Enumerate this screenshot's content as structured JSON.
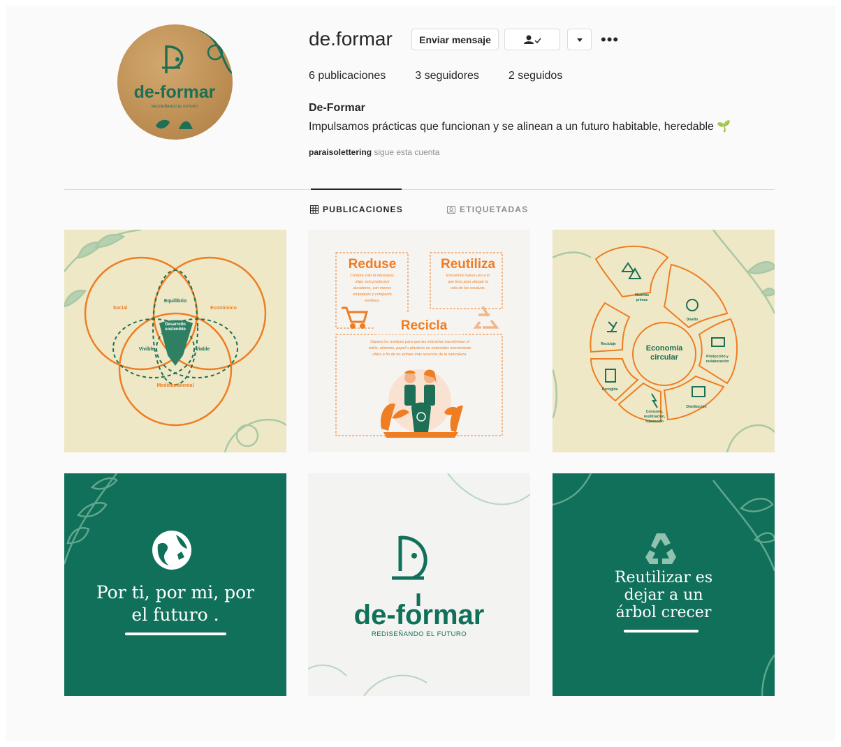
{
  "profile": {
    "username": "de.formar",
    "message_button": "Enviar mensaje",
    "more_dots": "•••",
    "stats": {
      "posts": "6 publicaciones",
      "followers": "3 seguidores",
      "following": "2 seguidos"
    },
    "full_name": "De-Formar",
    "bio": "Impulsamos prácticas que funcionan y se alinean a un futuro habitable, heredable 🌱",
    "followed_by_user": "paraisolettering",
    "followed_by_text": " sigue esta cuenta",
    "avatar": {
      "brand": "de-formar",
      "tagline": "REDISEÑANDO EL FUTURO"
    }
  },
  "tabs": {
    "posts": "PUBLICACIONES",
    "tagged": "ETIQUETADAS"
  },
  "posts": {
    "venn": {
      "social": "Social",
      "economico": "Económico",
      "medioambiental": "Medioambiental",
      "equilibrio": "Equilibrio",
      "desarrollo_1": "Desarrollo",
      "desarrollo_2": "sostenible",
      "vivible": "Vivible",
      "viable": "Viable"
    },
    "rrr": {
      "reduse": "Reduse",
      "reutiliza": "Reutiliza",
      "recicla": "Recicla",
      "reduse_1": "Compra solo lo necesario,",
      "reduse_2": "elige solo productos",
      "reduse_3": "duraderos, con menos",
      "reduse_4": "empaques y compacta",
      "reduse_5": "residuos.",
      "reutiliza_1": "Encuentra nuevo uso a lo",
      "reutiliza_2": "que tiras para alargar la",
      "reutiliza_3": "vida de los residuos.",
      "recicla_1": "Separa los residuos para que las industrias transformen el",
      "recicla_2": "vidrio, aluminio, papel o plásticos en materiales nuevamente",
      "recicla_3": "útiles a fin de no extraer más recursos de la naturaleza."
    },
    "circular": {
      "title_1": "Economía",
      "title_2": "circular",
      "materias": "Materias",
      "primas": "primas",
      "diseno": "Diseño",
      "produccion_1": "Producción y",
      "produccion_2": "reelaboración",
      "distribucion": "Distribución",
      "consumo_1": "Consumo,",
      "consumo_2": "reutilización,",
      "consumo_3": "reparación",
      "recogida": "Recogida",
      "reciclaje": "Reciclaje"
    },
    "green1": {
      "line1": "Por ti, por mi, por",
      "line2": "el futuro ."
    },
    "logo": {
      "brand": "de-formar",
      "tagline": "REDISEÑANDO EL FUTURO"
    },
    "green2": {
      "line1": "Reutilizar es",
      "line2": "dejar a un",
      "line3": "árbol crecer"
    }
  },
  "colors": {
    "teal": "#11705a",
    "orange": "#ef7d22",
    "cream": "#efe8c6",
    "leaf": "#a9c8a5"
  }
}
